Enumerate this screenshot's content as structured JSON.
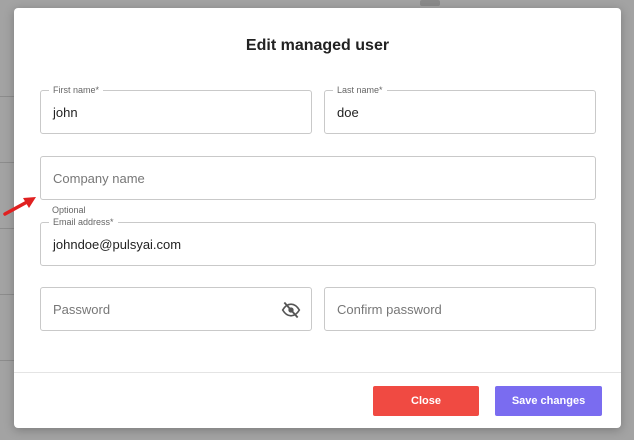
{
  "modal": {
    "title": "Edit managed user"
  },
  "form": {
    "first_name": {
      "label": "First name*",
      "value": "john"
    },
    "last_name": {
      "label": "Last name*",
      "value": "doe"
    },
    "company_name": {
      "placeholder": "Company name",
      "helper": "Optional"
    },
    "email": {
      "label": "Email address*",
      "value": "johndoe@pulsyai.com"
    },
    "password": {
      "placeholder": "Password",
      "icon": "eye-off-icon"
    },
    "confirm_password": {
      "placeholder": "Confirm password"
    }
  },
  "actions": {
    "close_label": "Close",
    "save_label": "Save changes"
  },
  "colors": {
    "close": "#f04a42",
    "save": "#7a6cf0",
    "annotation_arrow": "#e02020"
  }
}
